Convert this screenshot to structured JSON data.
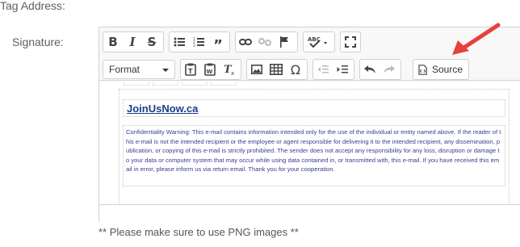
{
  "labels": {
    "tag_address": "Tag Address:",
    "signature": "Signature:"
  },
  "toolbar": {
    "format_label": "Format",
    "source_label": "Source",
    "icons_row1": [
      "bold-icon",
      "italic-icon",
      "strikethrough-icon",
      "bulleted-list-icon",
      "numbered-list-icon",
      "blockquote-icon",
      "link-icon",
      "unlink-icon",
      "anchor-icon",
      "spellcheck-icon",
      "maximize-icon"
    ],
    "icons_row2": [
      "paste-text-icon",
      "paste-word-icon",
      "remove-format-icon",
      "image-icon",
      "table-icon",
      "special-char-icon",
      "outdent-icon",
      "indent-icon",
      "undo-icon",
      "redo-icon",
      "source-icon"
    ]
  },
  "content": {
    "signature_link": "JoinUsNow.ca",
    "disclaimer": "Confidentiality Warning: This e-mail contains information intended only for the use of the individual or entity named above. If the reader of this e-mail is not the intended recipient or the employee or agent responsible for delivering it to the intended recipient, any dissemination, publication, or copying of this e-mail is strictly prohibited. The sender does not accept any responsibility for any loss, disruption or damage to your data or computer system that may occur while using data contained in, or transmitted with, this e-mail. If you have received this email in error, please inform us via return email. Thank you for your cooperation."
  },
  "note": "** Please make sure to use PNG images **",
  "colors": {
    "arrow": "#e8403b",
    "link": "#1b3d87",
    "disclaimer_text": "#3c3c96"
  }
}
